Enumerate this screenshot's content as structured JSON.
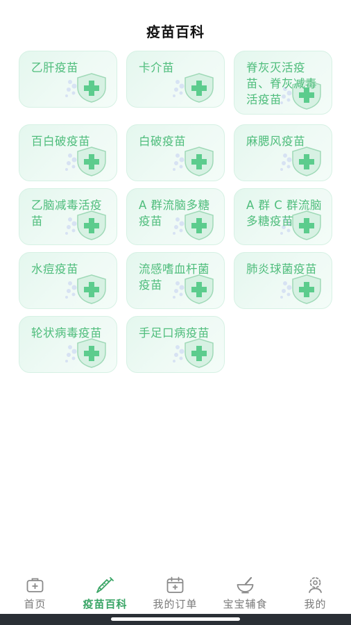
{
  "header": {
    "title": "疫苗百科"
  },
  "vaccines": [
    {
      "label": "乙肝疫苗"
    },
    {
      "label": "卡介苗"
    },
    {
      "label": "脊灰灭活疫苗、脊灰减毒活疫苗"
    },
    {
      "label": "百白破疫苗"
    },
    {
      "label": "白破疫苗"
    },
    {
      "label": "麻腮风疫苗"
    },
    {
      "label": "乙脑减毒活疫苗"
    },
    {
      "label": "A 群流脑多糖疫苗"
    },
    {
      "label": "A 群 C 群流脑多糖疫苗"
    },
    {
      "label": "水痘疫苗"
    },
    {
      "label": "流感嗜血杆菌疫苗"
    },
    {
      "label": "肺炎球菌疫苗"
    },
    {
      "label": "轮状病毒疫苗"
    },
    {
      "label": "手足口病疫苗"
    }
  ],
  "tabbar": {
    "active_index": 1,
    "active_color": "#3aa566",
    "inactive_color": "#7a7a7a",
    "items": [
      {
        "label": "首页",
        "icon": "medkit-icon"
      },
      {
        "label": "疫苗百科",
        "icon": "syringe-icon"
      },
      {
        "label": "我的订单",
        "icon": "calendar-plus-icon"
      },
      {
        "label": "宝宝辅食",
        "icon": "mortar-bowl-icon"
      },
      {
        "label": "我的",
        "icon": "user-gear-icon"
      }
    ]
  },
  "colors": {
    "card_text": "#4fbd7c",
    "card_bg": "#e4f7ee",
    "card_border": "#d6f1e4",
    "accent": "#3aa566"
  }
}
